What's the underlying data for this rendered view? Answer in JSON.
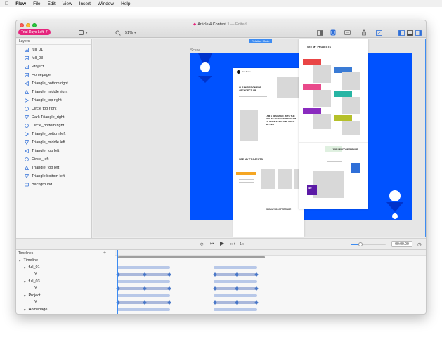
{
  "menubar": {
    "apple": "",
    "app": "Flow",
    "items": [
      "File",
      "Edit",
      "View",
      "Insert",
      "Window",
      "Help"
    ]
  },
  "window": {
    "trial_badge": "Trial Days Left: 7",
    "doc_title": "Article 4 Content 1",
    "doc_status": "— Edited",
    "zoom": "51%"
  },
  "sidebar": {
    "header": "Layers",
    "layers": [
      {
        "label": "full_01",
        "icon": "image-icon"
      },
      {
        "label": "full_03",
        "icon": "image-icon"
      },
      {
        "label": "Project",
        "icon": "image-icon"
      },
      {
        "label": "Homepage",
        "icon": "image-icon"
      },
      {
        "label": "Triangle_bottom right",
        "icon": "triangle-left-icon"
      },
      {
        "label": "Triangle_middle right",
        "icon": "triangle-up-icon"
      },
      {
        "label": "Triangle_top right",
        "icon": "triangle-right-icon"
      },
      {
        "label": "Circle top right",
        "icon": "circle-icon"
      },
      {
        "label": "Dark Triangle_right",
        "icon": "triangle-down-icon"
      },
      {
        "label": "Circle_bottom right",
        "icon": "circle-icon"
      },
      {
        "label": "Triangle_bottom left",
        "icon": "triangle-right-icon"
      },
      {
        "label": "Triangle_middle left",
        "icon": "triangle-down-icon"
      },
      {
        "label": "Triangle_top left",
        "icon": "triangle-left-icon"
      },
      {
        "label": "Circle_left",
        "icon": "circle-icon"
      },
      {
        "label": "Triangle_top left",
        "icon": "triangle-up-icon"
      },
      {
        "label": "Triangle bottom left",
        "icon": "triangle-down-icon"
      },
      {
        "label": "Background",
        "icon": "rectangle-icon"
      }
    ]
  },
  "canvas": {
    "mode_badge": "Relative Mode",
    "scene_label": "Scene",
    "accent": "#0052ff",
    "selection": "#3d8cf2",
    "mock": {
      "heading1": "CLEAN DESIGN FOR ARCHITECTURE",
      "heading2": "I AM A DESIGNER, WITH THE ABILITY TO SOLVE PROBLEM TO MAKE EVERYONE'S LIFE BETTER",
      "heading3": "SEE MY PROJECTS",
      "heading4": "JOIN MY CONFERENCE",
      "heading5": "SEE MY PROJECTS",
      "heading6": "JOIN MY CONFERENCE",
      "logo": "Flow Studio",
      "badge1": "40"
    }
  },
  "playback": {
    "speed": "1x",
    "time": "00:00.00"
  },
  "timelines": {
    "header": "Timelines",
    "rows": [
      {
        "label": "Timeline",
        "indent": 0,
        "caret": "▼"
      },
      {
        "label": "full_01",
        "indent": 1,
        "caret": "▼"
      },
      {
        "label": "Y",
        "indent": 2,
        "caret": ""
      },
      {
        "label": "full_03",
        "indent": 1,
        "caret": "▼"
      },
      {
        "label": "Y",
        "indent": 2,
        "caret": ""
      },
      {
        "label": "Project",
        "indent": 1,
        "caret": "▼"
      },
      {
        "label": "Y",
        "indent": 2,
        "caret": ""
      },
      {
        "label": "Homepage",
        "indent": 1,
        "caret": "▼"
      }
    ]
  }
}
